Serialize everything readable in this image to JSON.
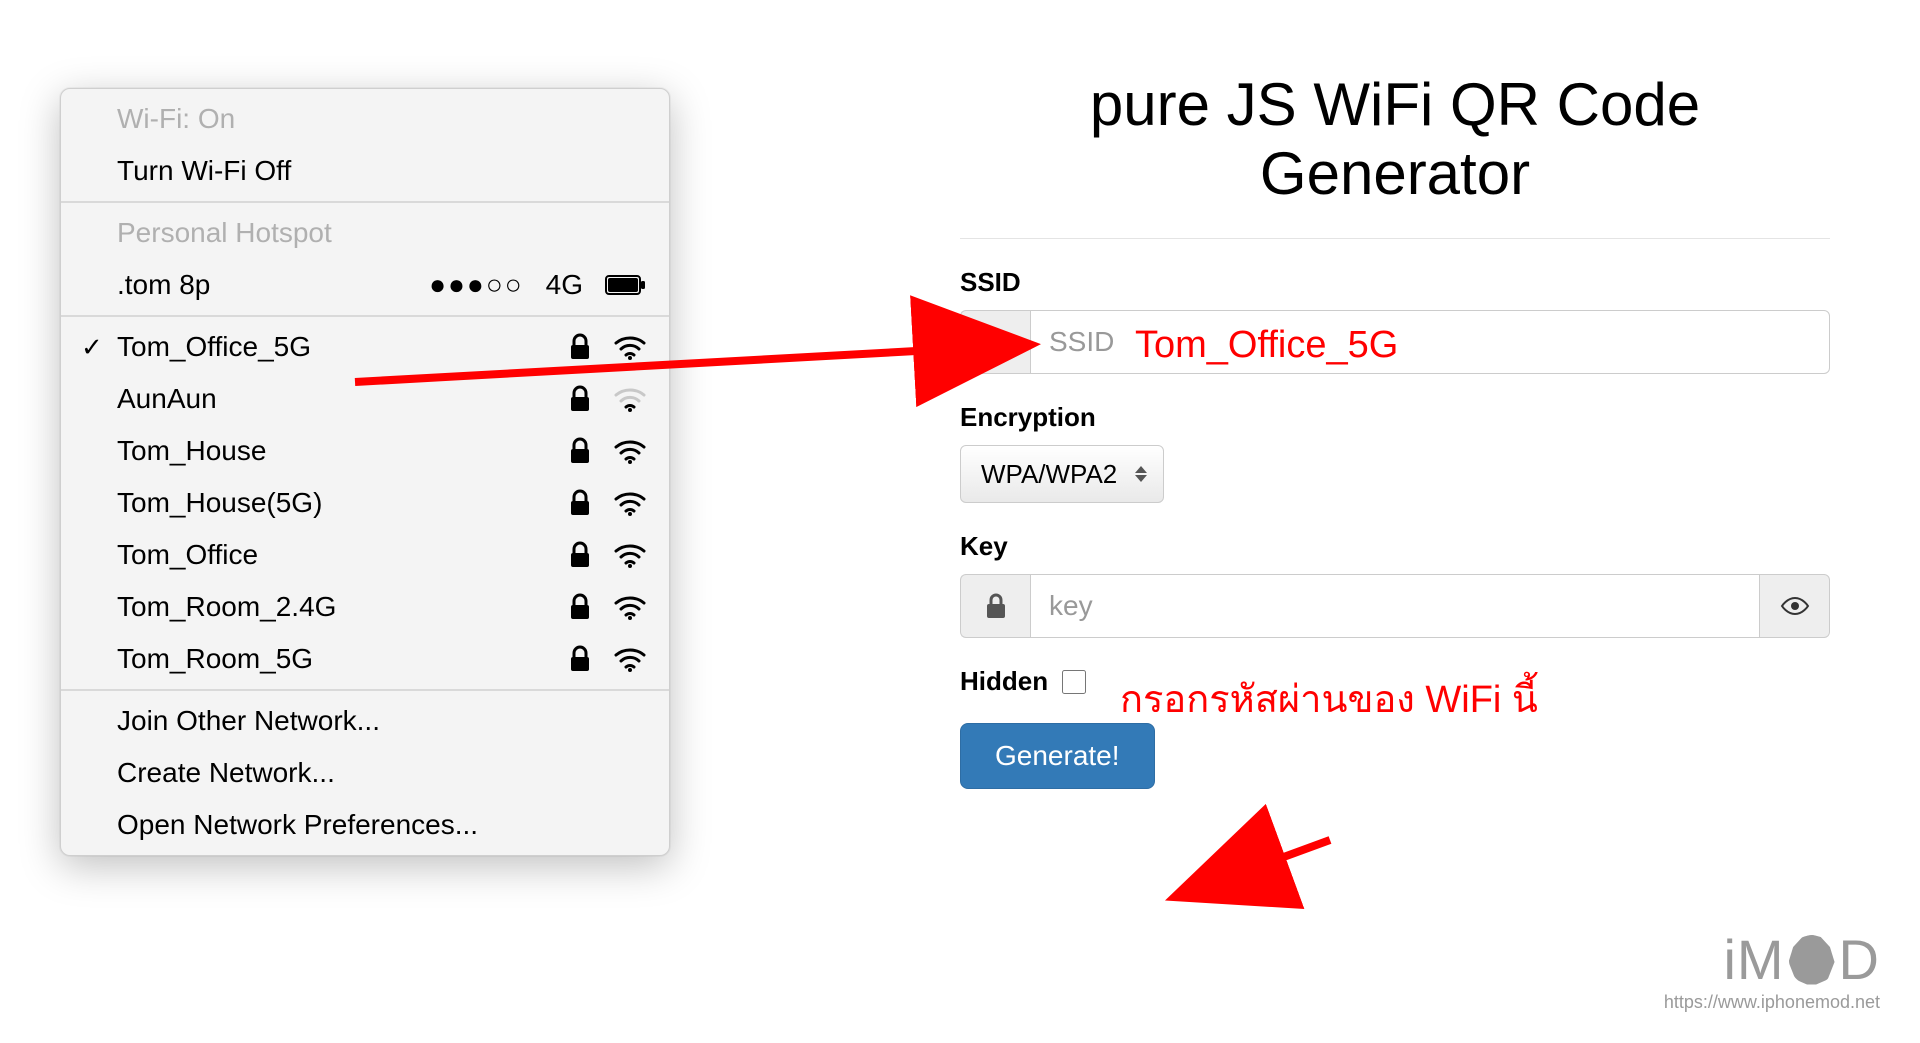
{
  "wifi_menu": {
    "status_label": "Wi-Fi: On",
    "toggle_label": "Turn Wi-Fi Off",
    "hotspot_header": "Personal Hotspot",
    "hotspot": {
      "name": ".tom 8p",
      "signal_dots": "●●●○○",
      "cell_label": "4G"
    },
    "networks": [
      {
        "name": "Tom_Office_5G",
        "connected": true,
        "locked": true,
        "strength": "strong"
      },
      {
        "name": "AunAun",
        "connected": false,
        "locked": true,
        "strength": "weak"
      },
      {
        "name": "Tom_House",
        "connected": false,
        "locked": true,
        "strength": "strong"
      },
      {
        "name": "Tom_House(5G)",
        "connected": false,
        "locked": true,
        "strength": "strong"
      },
      {
        "name": "Tom_Office",
        "connected": false,
        "locked": true,
        "strength": "strong"
      },
      {
        "name": "Tom_Room_2.4G",
        "connected": false,
        "locked": true,
        "strength": "strong"
      },
      {
        "name": "Tom_Room_5G",
        "connected": false,
        "locked": true,
        "strength": "strong"
      }
    ],
    "actions": {
      "join_other": "Join Other Network...",
      "create": "Create Network...",
      "prefs": "Open Network Preferences..."
    }
  },
  "form": {
    "title": "pure JS WiFi QR Code Generator",
    "ssid_label": "SSID",
    "ssid_placeholder": "SSID",
    "encryption_label": "Encryption",
    "encryption_value": "WPA/WPA2",
    "key_label": "Key",
    "key_placeholder": "key",
    "hidden_label": "Hidden",
    "generate_label": "Generate!"
  },
  "annotations": {
    "ssid_hint": "Tom_Office_5G",
    "key_hint": "กรอกรหัสผ่านของ WiFi นี้"
  },
  "watermark": {
    "brand_prefix": "iM",
    "brand_suffix": "D",
    "url": "https://www.iphonemod.net"
  }
}
